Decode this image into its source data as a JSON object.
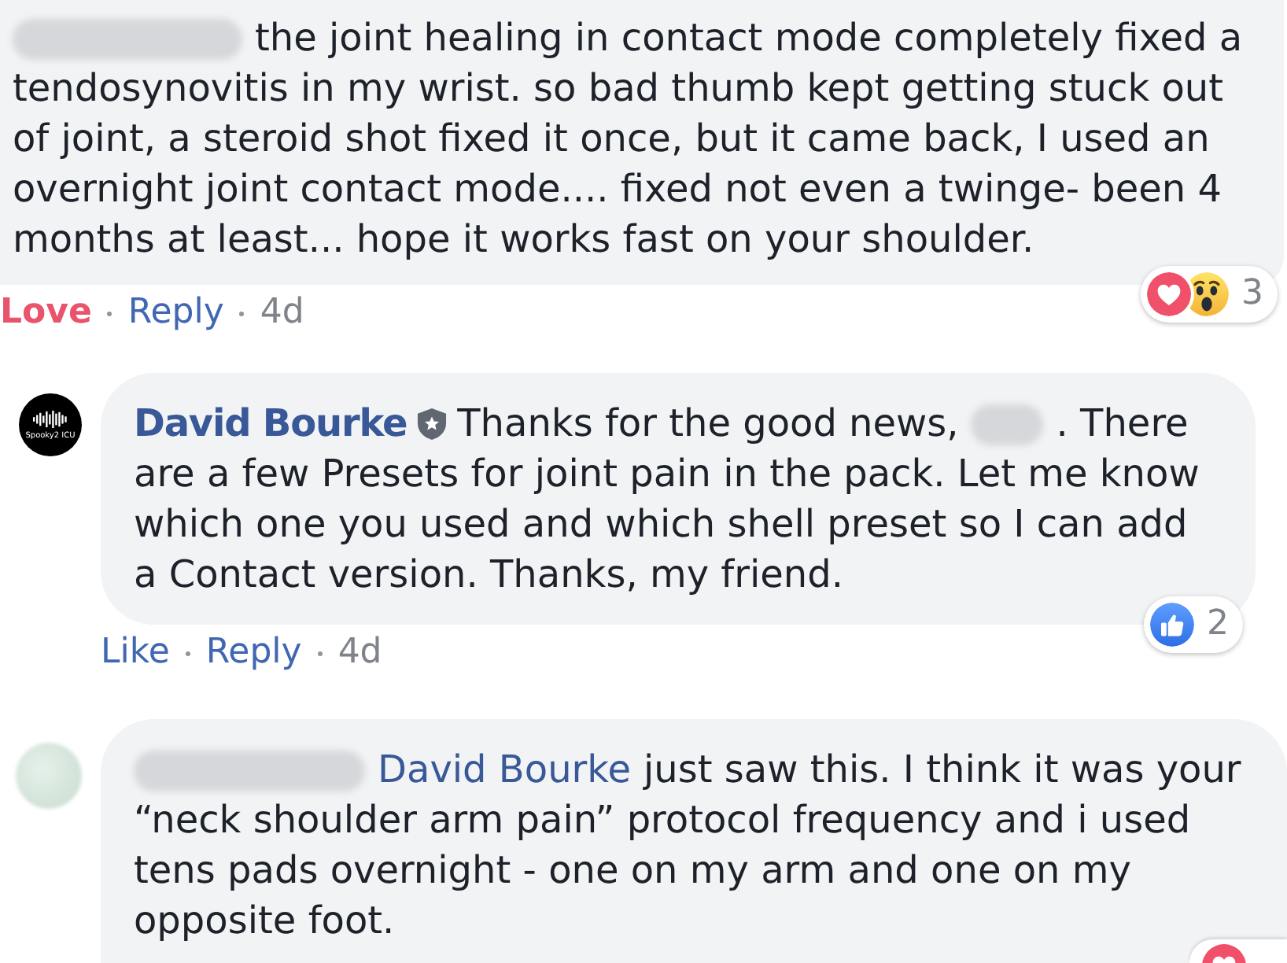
{
  "comments": [
    {
      "segments": [
        {
          "kind": "redacted"
        },
        {
          "kind": "text",
          "text": "the joint healing in contact mode completely fixed a\ntendosynovitis in my wrist. so bad thumb kept getting stuck out\nof joint, a steroid shot fixed it once, but it came back, I used an\novernight joint contact mode.... fixed not even a twinge- been 4\nmonths at least... hope it works fast on your shoulder."
        }
      ],
      "reactions": {
        "icons": [
          {
            "kind": "love"
          },
          {
            "kind": "wow"
          }
        ],
        "count": "3"
      },
      "actions": [
        {
          "kind": "reaction",
          "label": "Love",
          "active": true
        },
        {
          "kind": "reply",
          "label": "Reply"
        },
        {
          "kind": "time",
          "label": "4d"
        }
      ]
    },
    {
      "avatar": {
        "kind": "logo",
        "label": "Spooky2 ICU"
      },
      "segments": [
        {
          "kind": "author",
          "text": "David Bourke",
          "badge": true
        },
        {
          "kind": "text",
          "text": "Thanks for the good news,"
        },
        {
          "kind": "redacted"
        },
        {
          "kind": "text",
          "text": ". There\nare a few Presets for joint pain in the pack. Let me know\nwhich one you used and which shell preset so I can add\na Contact version. Thanks, my friend."
        }
      ],
      "reactions": {
        "icons": [
          {
            "kind": "like"
          }
        ],
        "count": "2"
      },
      "actions": [
        {
          "kind": "reaction",
          "label": "Like",
          "active": false
        },
        {
          "kind": "reply",
          "label": "Reply"
        },
        {
          "kind": "time",
          "label": "4d"
        }
      ]
    },
    {
      "avatar": {
        "kind": "blurred"
      },
      "segments": [
        {
          "kind": "redacted"
        },
        {
          "kind": "mention",
          "text": "David Bourke"
        },
        {
          "kind": "text",
          "text": "just saw this. I think it was your\n“neck shoulder arm pain” protocol frequency and i used\ntens pads overnight - one on my arm and one on my\nopposite foot."
        }
      ],
      "reactions": {
        "icons": [
          {
            "kind": "love"
          }
        ]
      }
    }
  ]
}
